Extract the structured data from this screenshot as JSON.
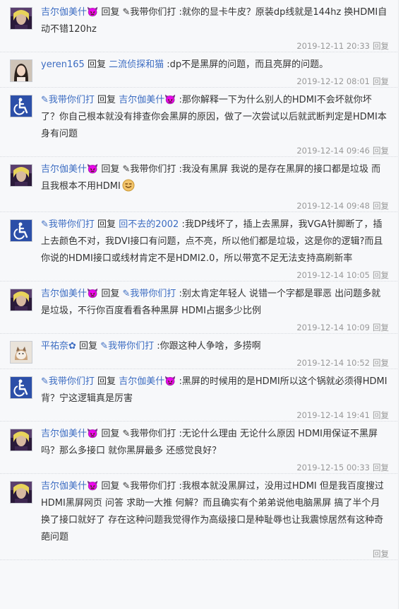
{
  "common": {
    "reply_word": "回复",
    "reply_action": "回复"
  },
  "replies": [
    {
      "avatar": "purple-portrait",
      "user": "吉尔伽美什👿",
      "target": "✎我带你们打",
      "target_link": false,
      "text": ":就你的显卡牛皮？原装dp线就是144hz 换HDMI自动不错120hz",
      "time": "2019-12-11 20:33"
    },
    {
      "avatar": "girl-portrait",
      "user": "yeren165",
      "target": "二流侦探和猫",
      "target_link": true,
      "text": ":dp不是黑屏的问题，而且亮屏的问题。",
      "time": "2019-12-12 08:01"
    },
    {
      "avatar": "wheelchair",
      "user": "✎我带你们打",
      "target": "吉尔伽美什👿",
      "target_link": true,
      "text": ":那你解释一下为什么别人的HDMI不会坏就你坏了？你自己根本就没有排查你会黑屏的原因，做了一次尝试以后就武断判定是HDMI本身有问题",
      "time": "2019-12-14 09:46"
    },
    {
      "avatar": "purple-portrait",
      "user": "吉尔伽美什👿",
      "target": "✎我带你们打",
      "target_link": false,
      "text": ":我没有黑屏 我说的是存在黑屏的接口都是垃圾 而且我根本不用HDMI",
      "emoji": "smile-face-icon",
      "time": "2019-12-14 09:48"
    },
    {
      "avatar": "wheelchair",
      "user": "✎我带你们打",
      "target": "回不去的2002",
      "target_link": true,
      "text": ":我DP线坏了，插上去黑屏，我VGA针脚断了，插上去颜色不对，我DVI接口有问题，点不亮，所以他们都是垃圾，这是你的逻辑?而且你说的HDMI接口或线材肯定不是HDMI2.0，所以带宽不足无法支持高刷新率",
      "time": "2019-12-14 10:05"
    },
    {
      "avatar": "purple-portrait",
      "user": "吉尔伽美什👿",
      "target": "✎我带你们打",
      "target_link": true,
      "text": ":别太肯定年轻人 说错一个字都是罪恶 出问题多就是垃圾，不行你百度看看各种黑屏 HDMI占据多少比例",
      "time": "2019-12-14 10:09"
    },
    {
      "avatar": "cat",
      "user": "平祐奈✿",
      "target": "✎我带你们打",
      "target_link": true,
      "text": ":你跟这种人争啥，多捞啊",
      "time": "2019-12-14 10:52"
    },
    {
      "avatar": "wheelchair",
      "user": "✎我带你们打",
      "target": "吉尔伽美什👿",
      "target_link": true,
      "text": ":黑屏的时候用的是HDMI所以这个锅就必须得HDMI背？宁这逻辑真是厉害",
      "time": "2019-12-14 19:41"
    },
    {
      "avatar": "purple-portrait",
      "user": "吉尔伽美什👿",
      "target": "✎我带你们打",
      "target_link": false,
      "text": ":无论什么理由 无论什么原因 HDMI用保证不黑屏吗？那么多接口 就你黑屏最多 还感觉良好？",
      "time": "2019-12-15 00:33"
    },
    {
      "avatar": "purple-portrait",
      "user": "吉尔伽美什👿",
      "target": "✎我带你们打",
      "target_link": false,
      "text": ":我根本就没黑屏过，没用过HDMI 但是我百度搜过 HDMI黑屏网页 问答 求助一大推 何解？而且确实有个弟弟说他电脑黑屏 搞了半个月换了接口就好了 存在这种问题我觉得作为高级接口是种耻辱也让我震惊居然有这种奇葩问题",
      "time": ""
    }
  ]
}
